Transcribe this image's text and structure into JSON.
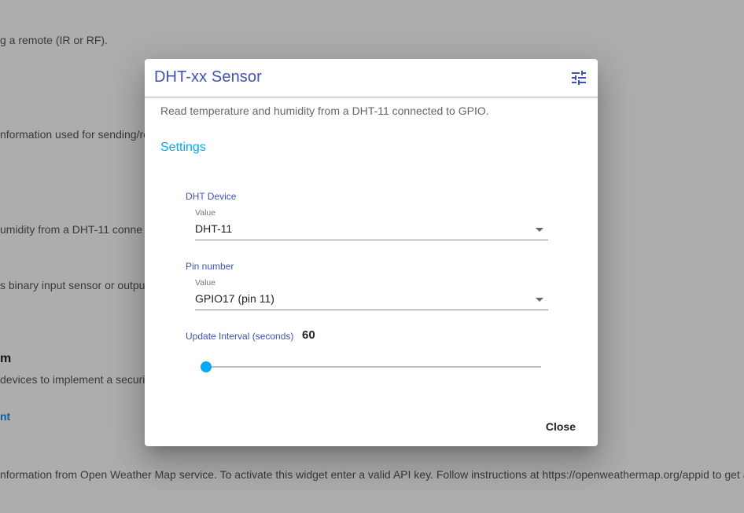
{
  "background": {
    "lines": [
      "g a remote (IR or RF).",
      "nformation used for sending/re",
      "umidity from a DHT-11 conne",
      "s binary input sensor or outpu",
      "m",
      "devices to implement a securit",
      "nt",
      "nformation from Open Weather Map service. To activate this widget enter a valid API key. Follow instructions at https://openweathermap.org/appid to get a"
    ]
  },
  "dialog": {
    "title": "DHT-xx Sensor",
    "tune_icon": "tune-icon",
    "description": "Read temperature and humidity from a DHT-11 connected to GPIO.",
    "settings_title": "Settings",
    "dht_device": {
      "label": "DHT Device",
      "sublabel": "Value",
      "value": "DHT-11"
    },
    "pin_number": {
      "label": "Pin number",
      "sublabel": "Value",
      "value": "GPIO17 (pin 11)"
    },
    "update_interval": {
      "label": "Update Interval (seconds)",
      "value": "60",
      "slider_fraction": 0
    },
    "close_label": "Close"
  },
  "colors": {
    "title": "#3f51b5",
    "accent": "#03a9f4",
    "overlay": "rgba(0,0,0,0.32)"
  }
}
